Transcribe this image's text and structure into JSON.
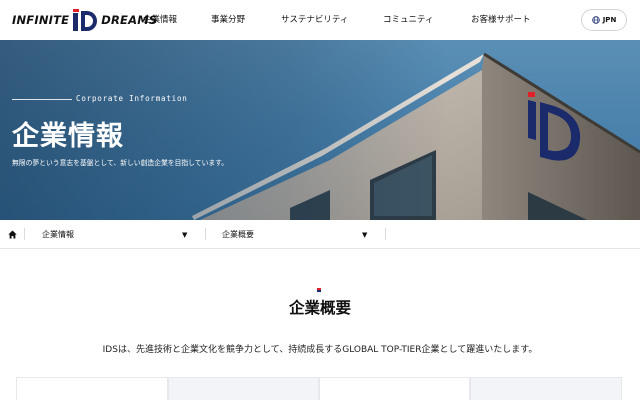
{
  "header": {
    "logo": {
      "left": "INFINITE",
      "right": "DREAMS"
    },
    "nav": [
      "企業情報",
      "事業分野",
      "サステナビリティ",
      "コミュニティ",
      "お客様サポート"
    ],
    "lang_label": "JPN"
  },
  "hero": {
    "subtitle": "Corporate Information",
    "title": "企業情報",
    "description": "無限の夢という意志を基盤として、新しい創造企業を目指しています。"
  },
  "breadcrumb": {
    "items": [
      {
        "label": "企業情報"
      },
      {
        "label": "企業概要"
      }
    ]
  },
  "content": {
    "title": "企業概要",
    "description": "IDSは、先進技術と企業文化を競争力として、持続成長するGLOBAL TOP-TIER企業として躍進いたします。"
  },
  "colors": {
    "brand_navy": "#1b2a6b",
    "brand_red": "#e1202a",
    "sky": "#4b83ad"
  },
  "icons": [
    "home-icon",
    "globe-icon",
    "caret-down-icon"
  ]
}
